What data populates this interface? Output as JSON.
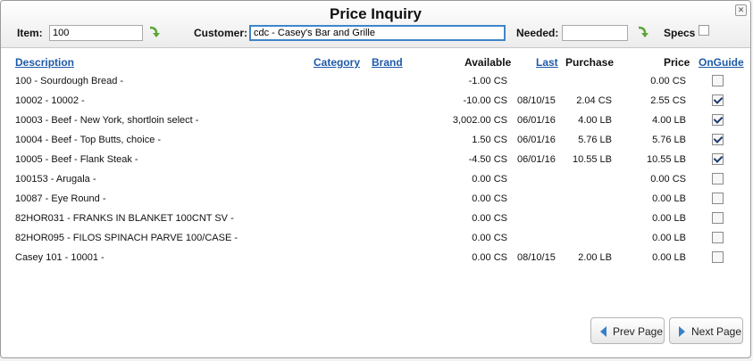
{
  "title": "Price Inquiry",
  "filters": {
    "item_label": "Item:",
    "item_value": "100",
    "customer_label": "Customer:",
    "customer_value": "cdc - Casey's Bar and Grille",
    "needed_label": "Needed:",
    "needed_value": "",
    "specs_label": "Specs",
    "specs_checked": false
  },
  "columns": {
    "description": "Description",
    "category": "Category",
    "brand": "Brand",
    "available": "Available",
    "last": "Last",
    "purchase": "Purchase",
    "price": "Price",
    "onguide": "OnGuide"
  },
  "rows": [
    {
      "description": "100 - Sourdough Bread -",
      "available": "-1.00 CS",
      "last": "",
      "purchase": "",
      "price": "0.00 CS",
      "onguide": false
    },
    {
      "description": "10002 - 10002 -",
      "available": "-10.00 CS",
      "last": "08/10/15",
      "purchase": "2.04 CS",
      "price": "2.55 CS",
      "onguide": true
    },
    {
      "description": "10003 - Beef - New York, shortloin select -",
      "available": "3,002.00 CS",
      "last": "06/01/16",
      "purchase": "4.00 LB",
      "price": "4.00 LB",
      "onguide": true
    },
    {
      "description": "10004 - Beef - Top Butts, choice -",
      "available": "1.50 CS",
      "last": "06/01/16",
      "purchase": "5.76 LB",
      "price": "5.76 LB",
      "onguide": true
    },
    {
      "description": "10005 - Beef - Flank Steak -",
      "available": "-4.50 CS",
      "last": "06/01/16",
      "purchase": "10.55 LB",
      "price": "10.55 LB",
      "onguide": true
    },
    {
      "description": "100153 - Arugala -",
      "available": "0.00 CS",
      "last": "",
      "purchase": "",
      "price": "0.00 CS",
      "onguide": false
    },
    {
      "description": "10087 - Eye Round -",
      "available": "0.00 CS",
      "last": "",
      "purchase": "",
      "price": "0.00 LB",
      "onguide": false
    },
    {
      "description": "82HOR031 - FRANKS IN BLANKET 100CNT SV -",
      "available": "0.00 CS",
      "last": "",
      "purchase": "",
      "price": "0.00 LB",
      "onguide": false
    },
    {
      "description": "82HOR095 - FILOS SPINACH PARVE 100/CASE -",
      "available": "0.00 CS",
      "last": "",
      "purchase": "",
      "price": "0.00 LB",
      "onguide": false
    },
    {
      "description": "Casey 101 - 10001 -",
      "available": "0.00 CS",
      "last": "08/10/15",
      "purchase": "2.00 LB",
      "price": "0.00 LB",
      "onguide": false
    }
  ],
  "pager": {
    "prev_label": "Prev Page",
    "next_label": "Next Page"
  },
  "icons": {
    "close": "close-icon",
    "go": "green-curved-arrow-icon",
    "prev": "triangle-left-icon",
    "next": "triangle-right-icon"
  },
  "colors": {
    "link": "#1e5aa8",
    "arrow_green": "#5aa538",
    "pager_triangle": "#3a7fc6"
  }
}
